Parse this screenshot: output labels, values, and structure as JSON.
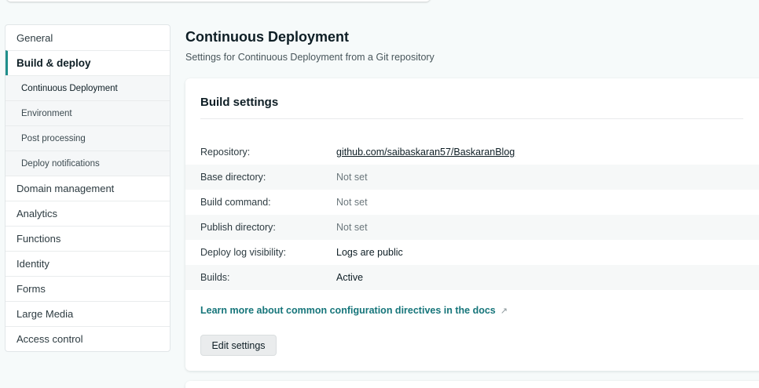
{
  "sidebar": {
    "items": [
      {
        "label": "General",
        "type": "top"
      },
      {
        "label": "Build & deploy",
        "type": "active"
      },
      {
        "label": "Continuous Deployment",
        "type": "sub-current"
      },
      {
        "label": "Environment",
        "type": "sub"
      },
      {
        "label": "Post processing",
        "type": "sub"
      },
      {
        "label": "Deploy notifications",
        "type": "sub"
      },
      {
        "label": "Domain management",
        "type": "top"
      },
      {
        "label": "Analytics",
        "type": "top"
      },
      {
        "label": "Functions",
        "type": "top"
      },
      {
        "label": "Identity",
        "type": "top"
      },
      {
        "label": "Forms",
        "type": "top"
      },
      {
        "label": "Large Media",
        "type": "top"
      },
      {
        "label": "Access control",
        "type": "top"
      }
    ]
  },
  "main": {
    "title": "Continuous Deployment",
    "subtitle": "Settings for Continuous Deployment from a Git repository"
  },
  "build_settings": {
    "title": "Build settings",
    "rows": [
      {
        "label": "Repository:",
        "value": "github.com/saibaskaran57/BaskaranBlog"
      },
      {
        "label": "Base directory:",
        "value": "Not set"
      },
      {
        "label": "Build command:",
        "value": "Not set"
      },
      {
        "label": "Publish directory:",
        "value": "Not set"
      },
      {
        "label": "Deploy log visibility:",
        "value": "Logs are public"
      },
      {
        "label": "Builds:",
        "value": "Active"
      }
    ],
    "docs_link": "Learn more about common configuration directives in the docs",
    "docs_link_icon": "external-link-icon",
    "edit_button": "Edit settings"
  },
  "colors": {
    "accent": "#1f8f8b",
    "link": "#16757a",
    "background": "#f6fafa"
  }
}
